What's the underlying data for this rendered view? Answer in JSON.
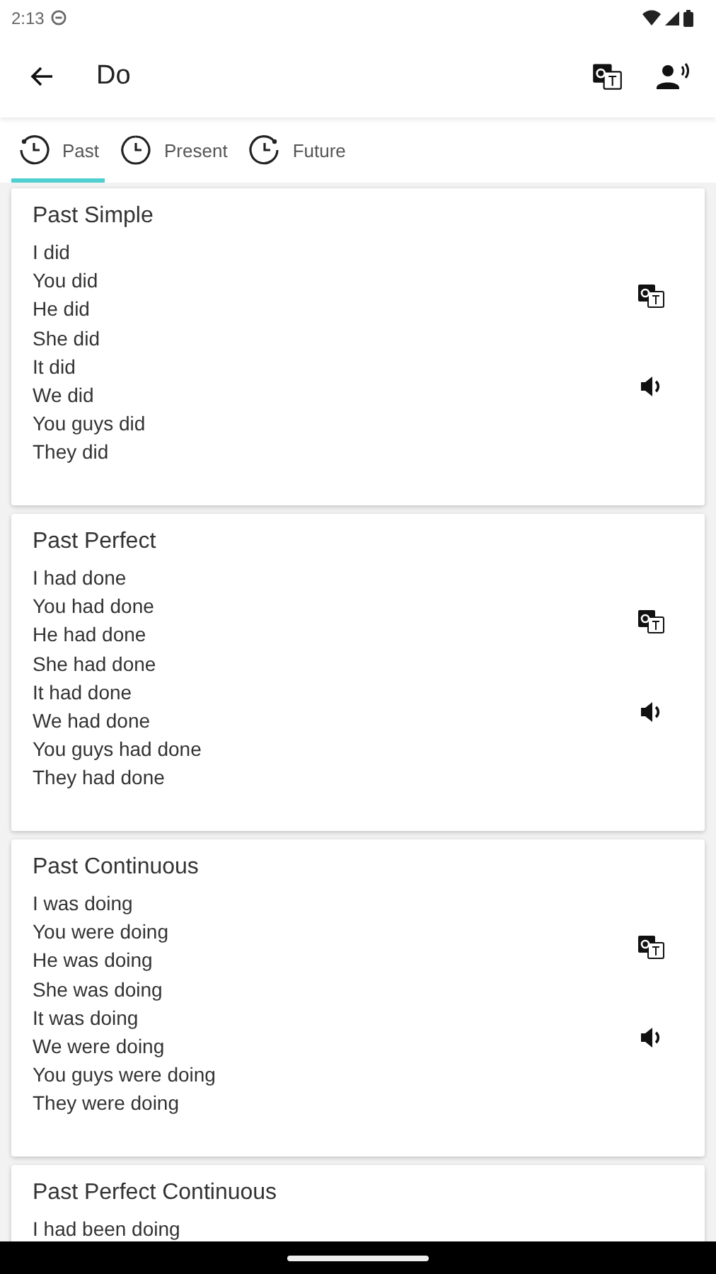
{
  "status_bar": {
    "time": "2:13"
  },
  "app_bar": {
    "title": "Do"
  },
  "tabs": [
    {
      "label": "Past",
      "selected": true
    },
    {
      "label": "Present",
      "selected": false
    },
    {
      "label": "Future",
      "selected": false
    }
  ],
  "cards": [
    {
      "title": "Past Simple",
      "lines": [
        "I did",
        "You did",
        "He did",
        "She did",
        "It did",
        "We did",
        "You guys did",
        "They did"
      ]
    },
    {
      "title": "Past Perfect",
      "lines": [
        "I had done",
        "You had done",
        "He had done",
        "She had done",
        "It had done",
        "We had done",
        "You guys had done",
        "They had done"
      ]
    },
    {
      "title": "Past Continuous",
      "lines": [
        "I was doing",
        "You were doing",
        "He was doing",
        "She was doing",
        "It was doing",
        "We were doing",
        "You guys were doing",
        "They were doing"
      ]
    },
    {
      "title": "Past Perfect Continuous",
      "lines": [
        "I had been doing"
      ]
    }
  ]
}
